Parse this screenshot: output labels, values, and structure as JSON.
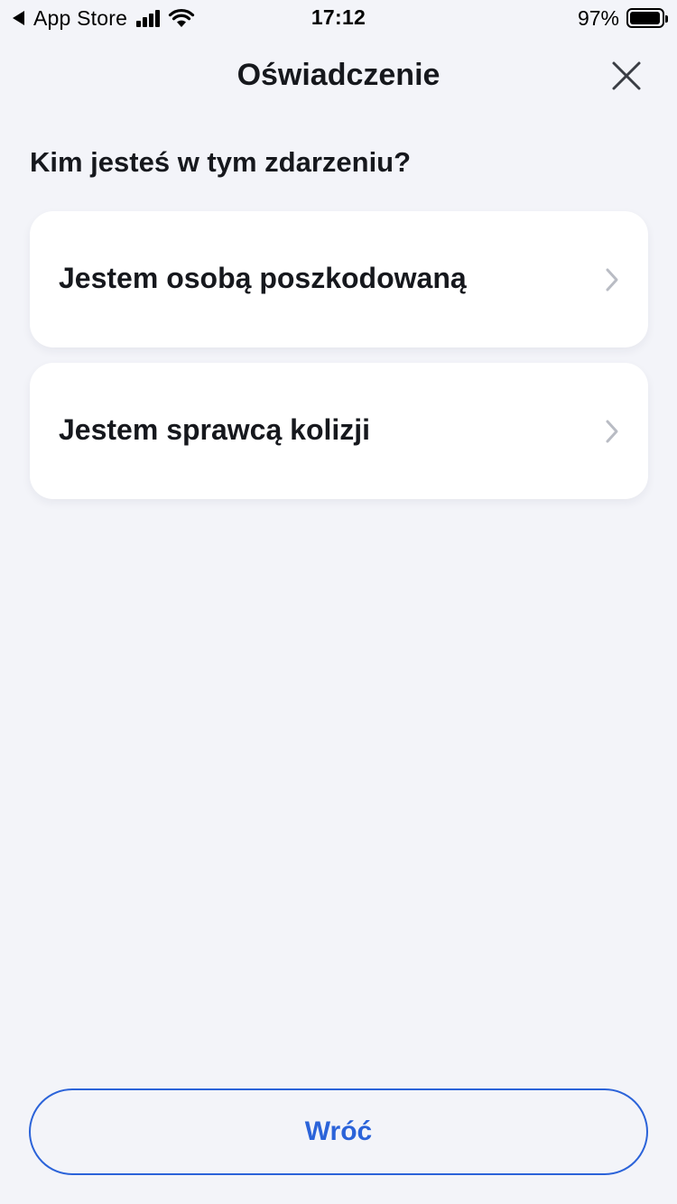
{
  "status_bar": {
    "back_app": "App Store",
    "time": "17:12",
    "battery_percent": "97%",
    "battery_level": 0.97,
    "signal_icon": "cellular-signal-icon",
    "wifi_icon": "wifi-icon",
    "battery_icon": "battery-icon"
  },
  "header": {
    "title": "Oświadczenie",
    "close_icon": "close-icon"
  },
  "question": "Kim jesteś w tym zdarzeniu?",
  "options": [
    {
      "label": "Jestem osobą poszkodowaną",
      "icon": "chevron-right-icon"
    },
    {
      "label": "Jestem sprawcą kolizji",
      "icon": "chevron-right-icon"
    }
  ],
  "footer": {
    "back_label": "Wróć"
  },
  "colors": {
    "background": "#f3f4f9",
    "card": "#ffffff",
    "text": "#16181d",
    "accent": "#2b63d9",
    "chevron": "#b9bcc4"
  }
}
